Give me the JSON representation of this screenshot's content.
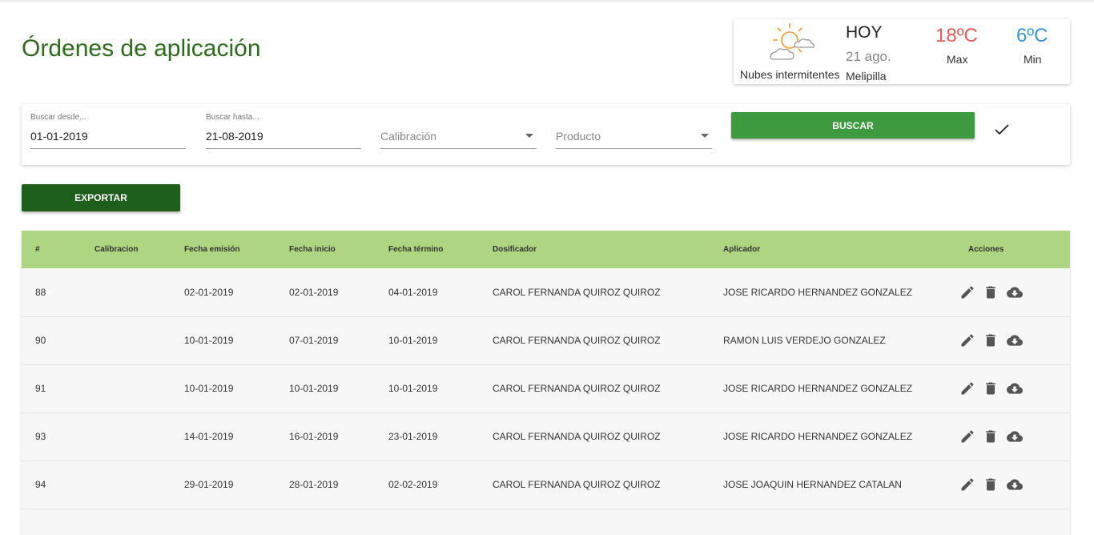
{
  "page": {
    "title": "Órdenes de aplicación"
  },
  "weather": {
    "icon": "partly-cloudy-icon",
    "description": "Nubes intermitentes",
    "day": "HOY",
    "date": "21 ago.",
    "place": "Melipilla",
    "max_temp": "18ºC",
    "max_label": "Max",
    "min_temp": "6ºC",
    "min_label": "Min"
  },
  "filters": {
    "from_label": "Buscar desde...",
    "from_value": "01-01-2019",
    "to_label": "Buscar hasta...",
    "to_value": "21-08-2019",
    "calibration_placeholder": "Calibración",
    "product_placeholder": "Producto",
    "search_label": "BUSCAR",
    "check_icon": "check-icon"
  },
  "export_label": "EXPORTAR",
  "table": {
    "headers": [
      "#",
      "Calibracion",
      "Fecha emisión",
      "Fecha inicio",
      "Fecha término",
      "Dosificador",
      "Aplicador",
      "Acciones"
    ],
    "rows": [
      {
        "id": "88",
        "calibracion": "",
        "emision": "02-01-2019",
        "inicio": "02-01-2019",
        "termino": "04-01-2019",
        "dosificador": "CAROL FERNANDA QUIROZ QUIROZ",
        "aplicador": "JOSE RICARDO HERNANDEZ GONZALEZ"
      },
      {
        "id": "90",
        "calibracion": "",
        "emision": "10-01-2019",
        "inicio": "07-01-2019",
        "termino": "10-01-2019",
        "dosificador": "CAROL FERNANDA QUIROZ QUIROZ",
        "aplicador": "RAMON LUIS VERDEJO GONZALEZ"
      },
      {
        "id": "91",
        "calibracion": "",
        "emision": "10-01-2019",
        "inicio": "10-01-2019",
        "termino": "10-01-2019",
        "dosificador": "CAROL FERNANDA QUIROZ QUIROZ",
        "aplicador": "JOSE RICARDO HERNANDEZ GONZALEZ"
      },
      {
        "id": "93",
        "calibracion": "",
        "emision": "14-01-2019",
        "inicio": "16-01-2019",
        "termino": "23-01-2019",
        "dosificador": "CAROL FERNANDA QUIROZ QUIROZ",
        "aplicador": "JOSE RICARDO HERNANDEZ GONZALEZ"
      },
      {
        "id": "94",
        "calibracion": "",
        "emision": "29-01-2019",
        "inicio": "28-01-2019",
        "termino": "02-02-2019",
        "dosificador": "CAROL FERNANDA QUIROZ QUIROZ",
        "aplicador": "JOSE JOAQUIN HERNANDEZ CATALAN"
      }
    ],
    "row_actions": [
      "edit-icon",
      "delete-icon",
      "cloud-download-icon"
    ]
  },
  "colors": {
    "title": "#2f6b1f",
    "search_button": "#3d9a3f",
    "export_button": "#1e5f1c",
    "table_header": "#aed581",
    "max_temp": "#e35d58",
    "min_temp": "#3a97d6"
  }
}
